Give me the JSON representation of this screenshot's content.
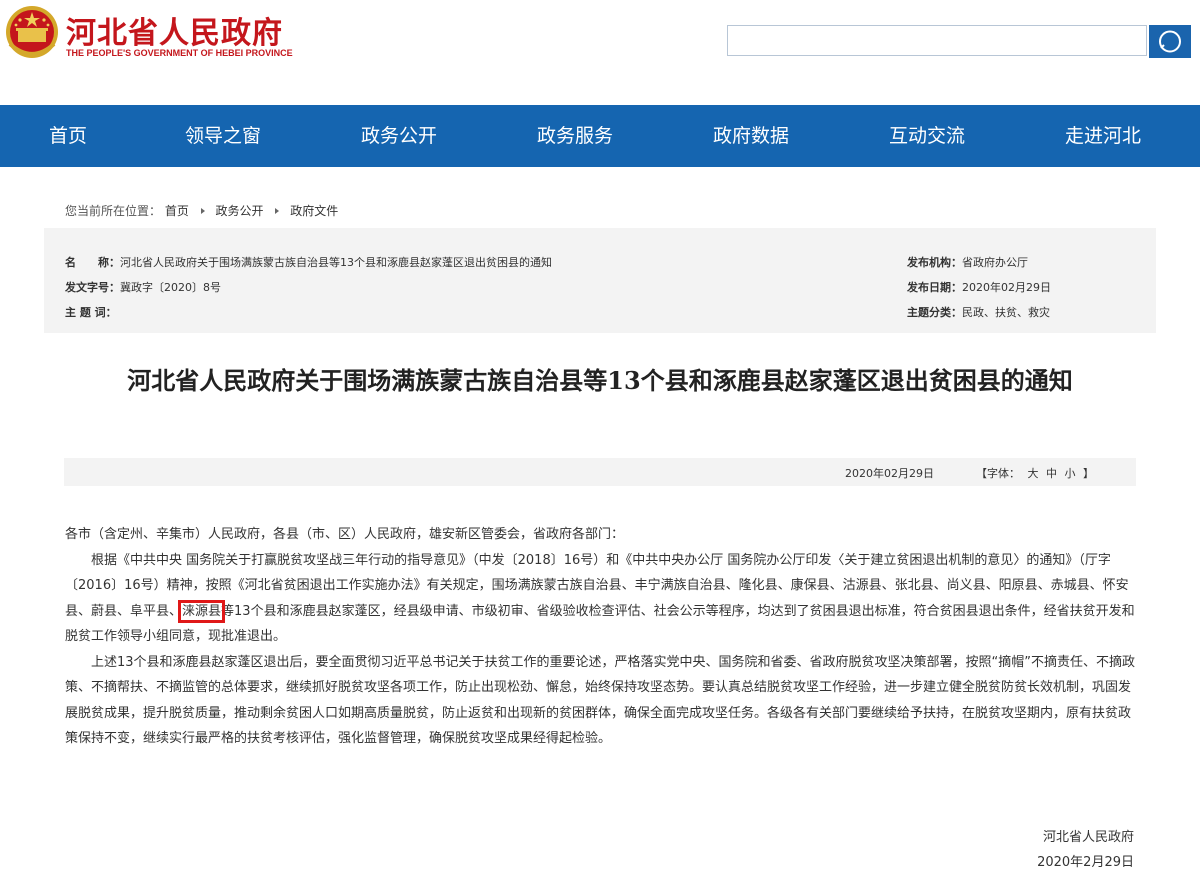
{
  "header": {
    "site_title": "河北省人民政府",
    "site_subtitle": "THE PEOPLE'S GOVERNMENT OF HEBEI PROVINCE",
    "search_placeholder": ""
  },
  "nav": {
    "items": [
      "首页",
      "领导之窗",
      "政务公开",
      "政务服务",
      "政府数据",
      "互动交流",
      "走进河北"
    ]
  },
  "breadcrumb": {
    "label": "您当前所在位置：",
    "items": [
      "首页",
      "政务公开",
      "政府文件"
    ]
  },
  "meta": {
    "name_label": "名　　称：",
    "name_value": "河北省人民政府关于围场满族蒙古族自治县等13个县和涿鹿县赵家蓬区退出贫困县的通知",
    "doc_no_label": "发文字号：",
    "doc_no_value": "冀政字〔2020〕8号",
    "keywords_label": "主 题 词：",
    "keywords_value": "",
    "publisher_label": "发布机构：",
    "publisher_value": "省政府办公厅",
    "date_label": "发布日期：",
    "date_value": "2020年02月29日",
    "category_label": "主题分类：",
    "category_value": "民政、扶贫、救灾"
  },
  "document": {
    "title": "河北省人民政府关于围场满族蒙古族自治县等13个县和涿鹿县赵家蓬区退出贫困县的通知",
    "date": "2020年02月29日",
    "font_label": "【字体：",
    "font_large": "大",
    "font_medium": "中",
    "font_small": "小",
    "font_close": "】",
    "salutation": "各市（含定州、辛集市）人民政府，各县（市、区）人民政府，雄安新区管委会，省政府各部门：",
    "p1_before": "根据《中共中央 国务院关于打赢脱贫攻坚战三年行动的指导意见》（中发〔2018〕16号）和《中共中央办公厅 国务院办公厅印发〈关于建立贫困退出机制的意见〉的通知》（厅字〔2016〕16号）精神，按照《河北省贫困退出工作实施办法》有关规定，围场满族蒙古族自治县、丰宁满族自治县、隆化县、康保县、沽源县、张北县、尚义县、阳原县、赤城县、怀安县、蔚县、阜平县、",
    "p1_highlight": "涞源县",
    "p1_after": "等13个县和涿鹿县赵家蓬区，经县级申请、市级初审、省级验收检查评估、社会公示等程序，均达到了贫困县退出标准，符合贫困县退出条件，经省扶贫开发和脱贫工作领导小组同意，现批准退出。",
    "p2": "上述13个县和涿鹿县赵家蓬区退出后，要全面贯彻习近平总书记关于扶贫工作的重要论述，严格落实党中央、国务院和省委、省政府脱贫攻坚决策部署，按照“摘帽”不摘责任、不摘政策、不摘帮扶、不摘监管的总体要求，继续抓好脱贫攻坚各项工作，防止出现松劲、懈怠，始终保持攻坚态势。要认真总结脱贫攻坚工作经验，进一步建立健全脱贫防贫长效机制，巩固发展脱贫成果，提升脱贫质量，推动剩余贫困人口如期高质量脱贫，防止返贫和出现新的贫困群体，确保全面完成攻坚任务。各级各有关部门要继续给予扶持，在脱贫攻坚期内，原有扶贫政策保持不变，继续实行最严格的扶贫考核评估，强化监督管理，确保脱贫攻坚成果经得起检验。",
    "sign_org": "河北省人民政府",
    "sign_date": "2020年2月29日"
  },
  "colors": {
    "brand_red": "#c4161c",
    "nav_blue": "#1565b0",
    "highlight_red": "#e01818"
  },
  "icons": {
    "emblem": "national-emblem-icon",
    "search": "search-icon"
  }
}
